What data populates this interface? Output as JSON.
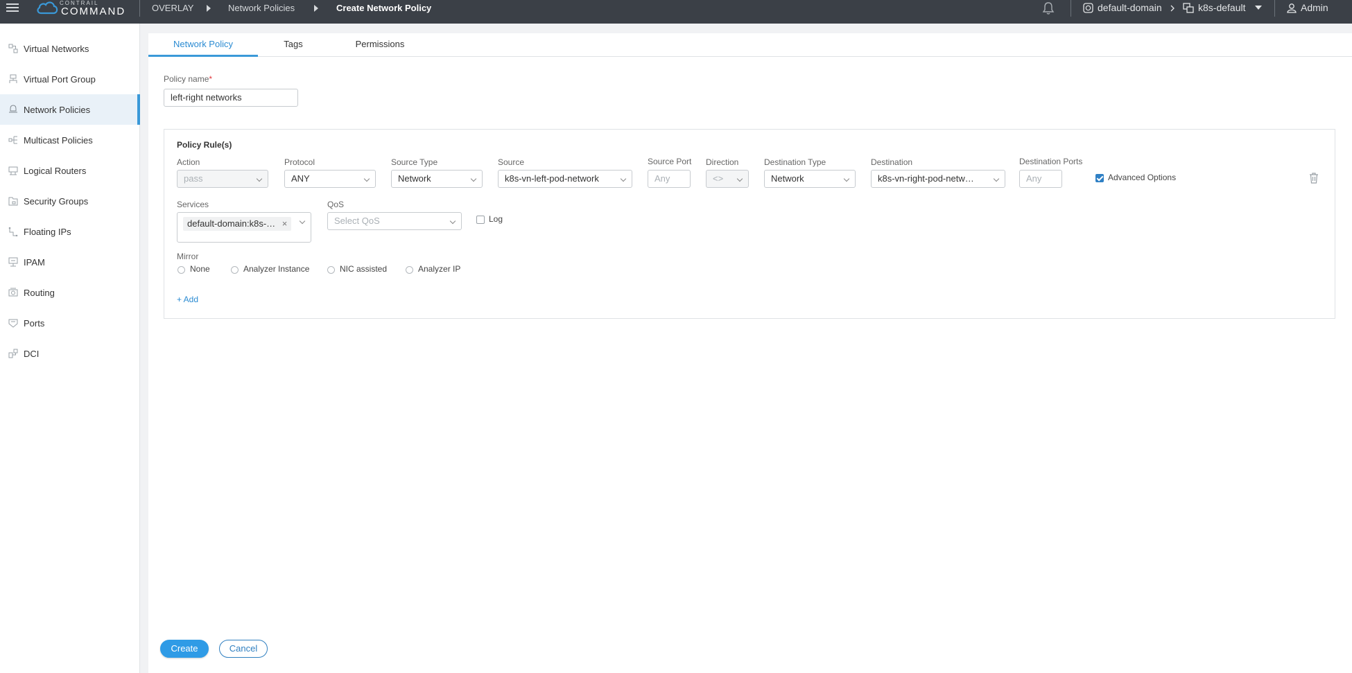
{
  "header": {
    "logo_top": "CONTRAIL",
    "logo_bottom": "COMMAND",
    "breadcrumb": [
      "OVERLAY",
      "Network Policies",
      "Create Network Policy"
    ],
    "domain": "default-domain",
    "project": "k8s-default",
    "user": "Admin"
  },
  "sidebar": {
    "items": [
      {
        "label": "Virtual Networks",
        "icon": "virtual-networks-icon"
      },
      {
        "label": "Virtual Port Group",
        "icon": "port-group-icon"
      },
      {
        "label": "Network Policies",
        "icon": "network-policies-icon",
        "active": true
      },
      {
        "label": "Multicast Policies",
        "icon": "multicast-icon"
      },
      {
        "label": "Logical Routers",
        "icon": "router-icon"
      },
      {
        "label": "Security Groups",
        "icon": "security-groups-icon"
      },
      {
        "label": "Floating IPs",
        "icon": "floating-ip-icon"
      },
      {
        "label": "IPAM",
        "icon": "ipam-icon"
      },
      {
        "label": "Routing",
        "icon": "routing-icon"
      },
      {
        "label": "Ports",
        "icon": "ports-icon"
      },
      {
        "label": "DCI",
        "icon": "dci-icon"
      }
    ]
  },
  "tabs": [
    "Network Policy",
    "Tags",
    "Permissions"
  ],
  "form": {
    "policy_name_label": "Policy name",
    "policy_name_required": "*",
    "policy_name_value": "left-right networks",
    "rules_title": "Policy Rule(s)",
    "action_label": "Action",
    "action_value": "pass",
    "protocol_label": "Protocol",
    "protocol_value": "ANY",
    "source_type_label": "Source Type",
    "source_type_value": "Network",
    "source_label": "Source",
    "source_value": "k8s-vn-left-pod-network",
    "source_port_label": "Source Port",
    "source_port_placeholder": "Any",
    "direction_label": "Direction",
    "direction_value": "<>",
    "destination_type_label": "Destination Type",
    "destination_type_value": "Network",
    "destination_label": "Destination",
    "destination_value": "k8s-vn-right-pod-netw…",
    "destination_ports_label": "Destination Ports",
    "destination_ports_placeholder": "Any",
    "advanced_options_label": "Advanced Options",
    "advanced_options_checked": true,
    "services_label": "Services",
    "services_tag": "default-domain:k8s-…",
    "services_tag_remove": "×",
    "qos_label": "QoS",
    "qos_placeholder": "Select QoS",
    "log_label": "Log",
    "mirror_label": "Mirror",
    "mirror_options": [
      "None",
      "Analyzer Instance",
      "NIC assisted",
      "Analyzer IP"
    ],
    "add_label": "+ Add"
  },
  "footer": {
    "create_label": "Create",
    "cancel_label": "Cancel"
  },
  "colors": {
    "topbar": "#3b4047",
    "accent": "#3a99d8",
    "primary_button": "#2f9be6"
  }
}
